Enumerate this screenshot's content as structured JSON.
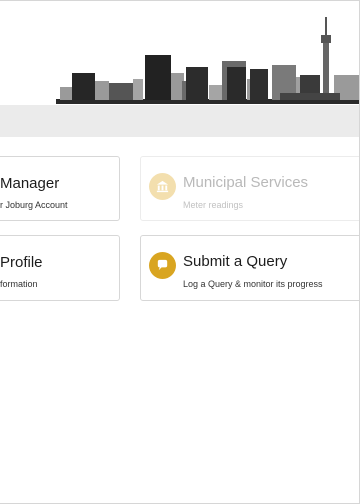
{
  "cards": {
    "manager": {
      "title": "Manager",
      "subtitle": "r Joburg Account"
    },
    "profile": {
      "title": "Profile",
      "subtitle": "formation"
    },
    "municipal": {
      "title": "Municipal Services",
      "subtitle": "Meter readings",
      "icon": "building-icon",
      "disabled": true
    },
    "query": {
      "title": "Submit a Query",
      "subtitle": "Log a Query & monitor its progress",
      "icon": "chat-bubble-icon"
    }
  },
  "colors": {
    "accent": "#d9a521",
    "accent_light": "#f3dfae",
    "band": "#ebebeb",
    "skyline_dark": "#2a2a2a",
    "skyline_mid": "#6a6a6a",
    "skyline_light": "#9a9a9a"
  }
}
